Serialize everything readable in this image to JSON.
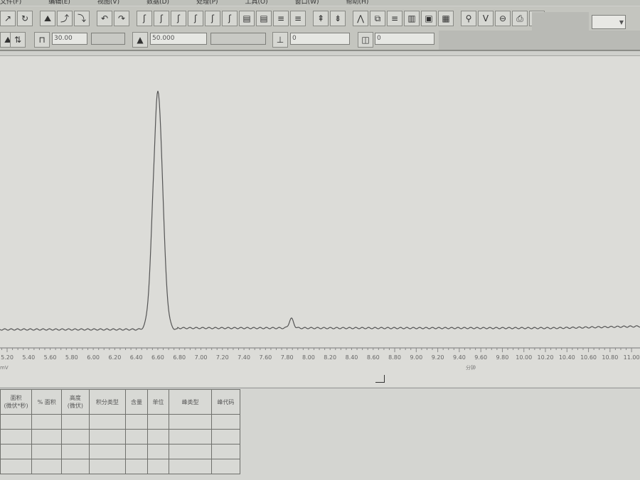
{
  "menu": [
    "文件(F)",
    "编辑(E)",
    "视图(V)",
    "数据(D)",
    "处理(P)",
    "工具(O)",
    "窗口(W)",
    "帮助(H)"
  ],
  "toolbar": {
    "icons": [
      "peak-icon",
      "integrate-icon",
      "baseline-icon",
      "cursor-icon",
      "marker-icon",
      "undo-icon",
      "redo-icon",
      "peak-start-icon",
      "peak-end-icon",
      "split-icon",
      "merge-icon",
      "tangent-icon",
      "skim-icon",
      "group-icon",
      "ungroup-icon",
      "list-icon",
      "list2-icon",
      "zoom-in-icon",
      "zoom-out-icon",
      "view-icon",
      "copy-icon",
      "table-icon",
      "report-icon",
      "print-icon",
      "export-icon",
      "run-icon",
      "stop-icon",
      "calibrate-icon",
      "print2-icon",
      "settings-icon"
    ],
    "dropdown_value": ""
  },
  "toolbar2": {
    "width_value": "30.00",
    "threshold_value": "50.000",
    "min_height_value": "0",
    "min_area_value": "0"
  },
  "chart_data": {
    "type": "line",
    "xlabel": "分钟",
    "ylabel": "mV",
    "xlim": [
      5.15,
      11.02
    ],
    "x_ticks": [
      "5.20",
      "5.40",
      "5.60",
      "5.80",
      "6.00",
      "6.20",
      "6.40",
      "6.60",
      "6.80",
      "7.00",
      "7.20",
      "7.40",
      "7.60",
      "7.80",
      "8.00",
      "8.20",
      "8.40",
      "8.60",
      "8.80",
      "9.00",
      "9.20",
      "9.40",
      "9.60",
      "9.80",
      "10.00",
      "10.20",
      "10.40",
      "10.60",
      "10.80",
      "11.00"
    ],
    "peaks": [
      {
        "retention_time": 6.6,
        "relative_height": 1.0
      },
      {
        "retention_time": 7.84,
        "relative_height": 0.04
      }
    ],
    "grid": false,
    "line_color": "#555555"
  },
  "results_table": {
    "headers": [
      "面积\n(微伏*秒)",
      "% 面积",
      "高度\n(微伏)",
      "积分类型",
      "含量",
      "单位",
      "峰类型",
      "峰代码"
    ],
    "rows": [
      [
        "",
        "",
        "",
        "",
        "",
        "",
        "",
        ""
      ],
      [
        "",
        "",
        "",
        "",
        "",
        "",
        "",
        ""
      ],
      [
        "",
        "",
        "",
        "",
        "",
        "",
        "",
        ""
      ],
      [
        "",
        "",
        "",
        "",
        "",
        "",
        "",
        ""
      ]
    ]
  }
}
